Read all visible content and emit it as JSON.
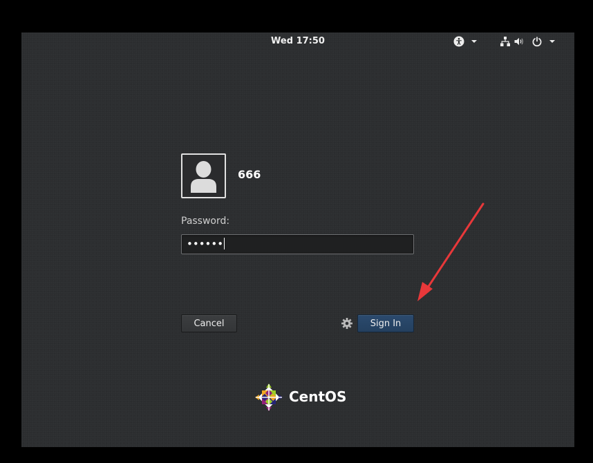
{
  "topbar": {
    "clock": "Wed 17:50",
    "accessibility_icon": "accessibility-icon",
    "network_icon": "network-wired-icon",
    "volume_icon": "volume-icon",
    "power_icon": "power-icon"
  },
  "login": {
    "username": "666",
    "password_label": "Password:",
    "password_value": "••••••"
  },
  "buttons": {
    "cancel": "Cancel",
    "sign_in": "Sign In"
  },
  "branding": {
    "name": "CentOS"
  },
  "colors": {
    "background": "#2c2e30",
    "primary_button": "#2b4a6e",
    "annotation_arrow": "#e8383a"
  }
}
